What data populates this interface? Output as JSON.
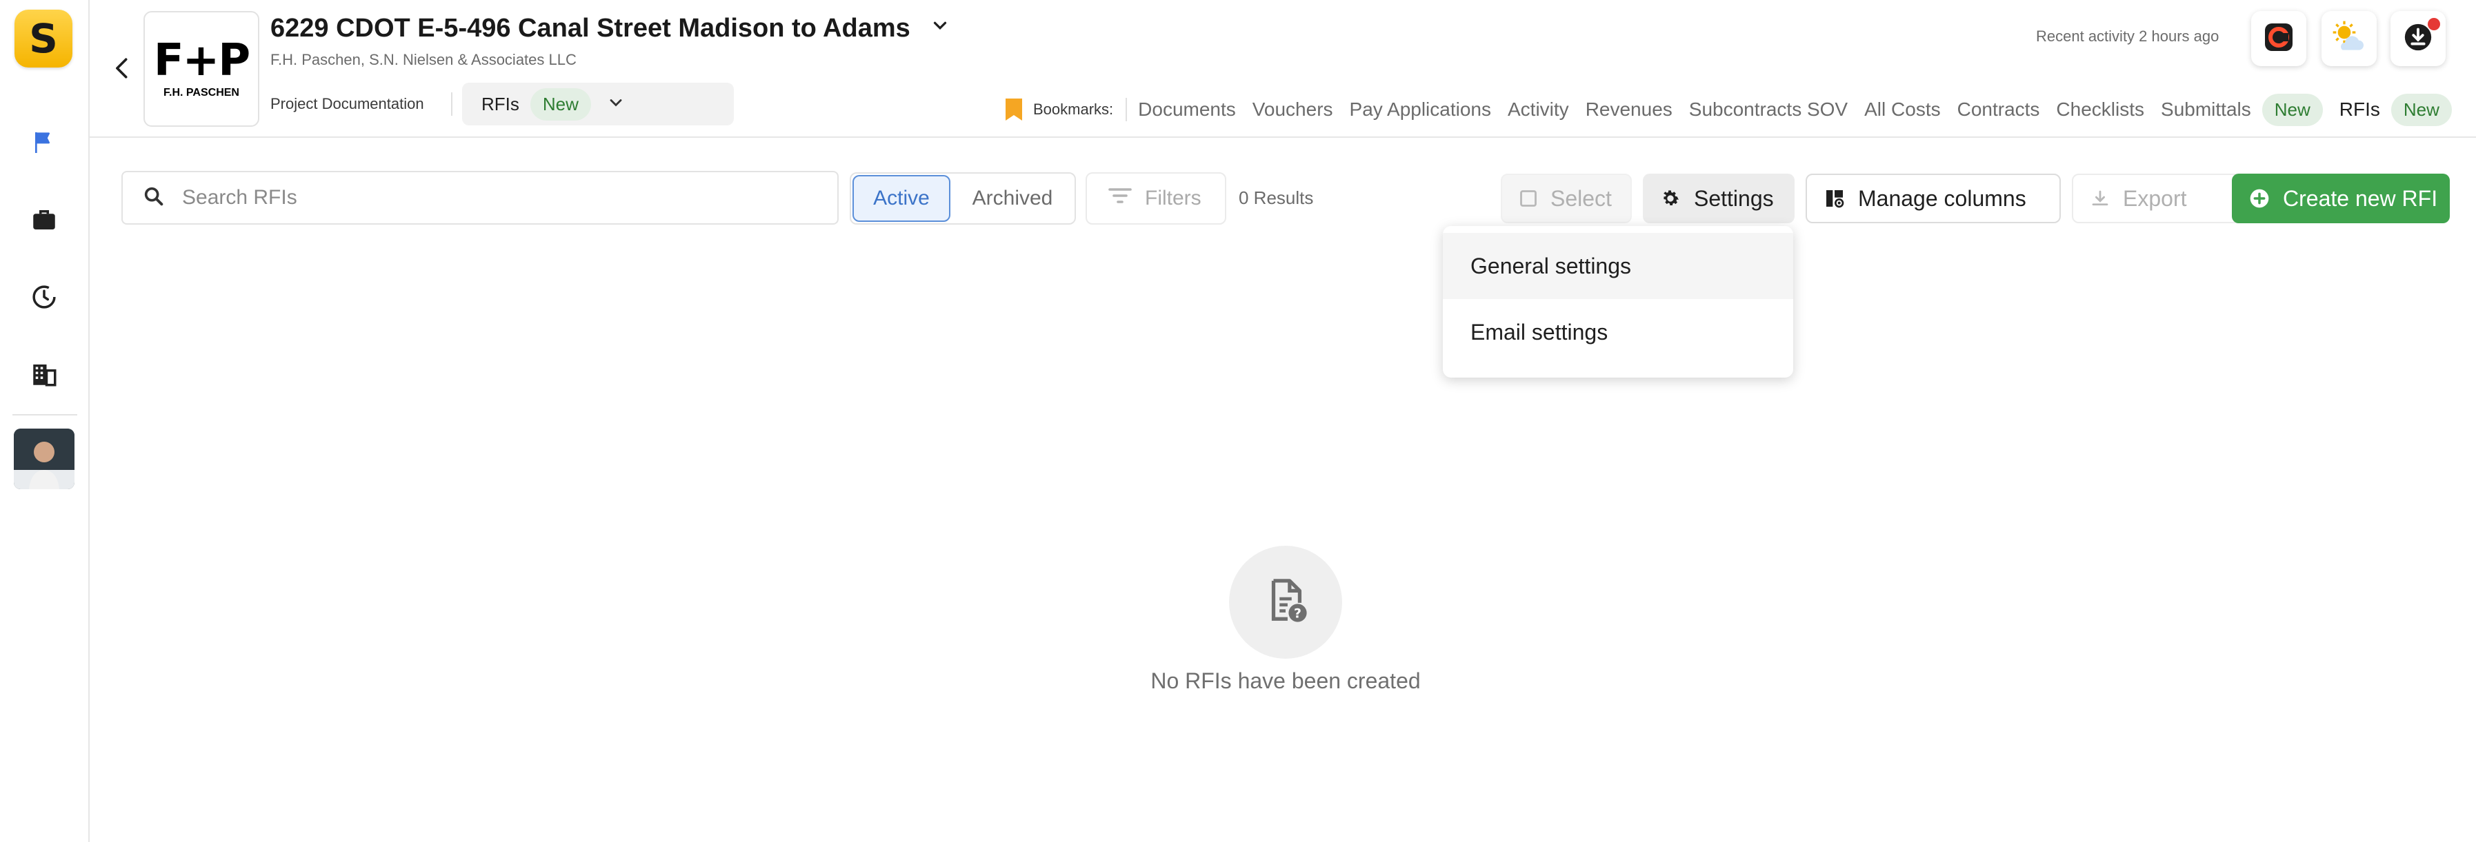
{
  "app": {
    "logo_letter": "S"
  },
  "project": {
    "logo_big": "F+P",
    "logo_small": "F.H. PASCHEN",
    "title": "6229 CDOT E-5-496 Canal Street Madison to Adams",
    "subtitle": "F.H. Paschen, S.N. Nielsen & Associates LLC",
    "section_label": "Project Documentation",
    "module_label": "RFIs",
    "module_badge": "New"
  },
  "header": {
    "recent_activity": "Recent activity 2 hours ago",
    "bookmarks_label": "Bookmarks:",
    "links": [
      {
        "label": "Documents"
      },
      {
        "label": "Vouchers"
      },
      {
        "label": "Pay Applications"
      },
      {
        "label": "Activity"
      },
      {
        "label": "Revenues"
      },
      {
        "label": "Subcontracts SOV"
      },
      {
        "label": "All Costs"
      },
      {
        "label": "Contracts"
      },
      {
        "label": "Checklists"
      },
      {
        "label": "Submittals",
        "badge": "New"
      },
      {
        "label": "RFIs",
        "badge": "New"
      }
    ]
  },
  "toolbar": {
    "search_placeholder": "Search RFIs",
    "tab_active": "Active",
    "tab_archived": "Archived",
    "filters_label": "Filters",
    "results": "0 Results",
    "select_label": "Select",
    "settings_label": "Settings",
    "manage_columns_label": "Manage columns",
    "export_label": "Export",
    "create_label": "Create new RFI"
  },
  "settings_menu": {
    "items": [
      "General settings",
      "Email settings"
    ]
  },
  "empty_state": {
    "message": "No RFIs have been created"
  },
  "colors": {
    "primary_green": "#3fa34d",
    "active_blue": "#3b73c8",
    "brand_yellow": "#f5b400",
    "badge_green_bg": "#e3efe4"
  }
}
